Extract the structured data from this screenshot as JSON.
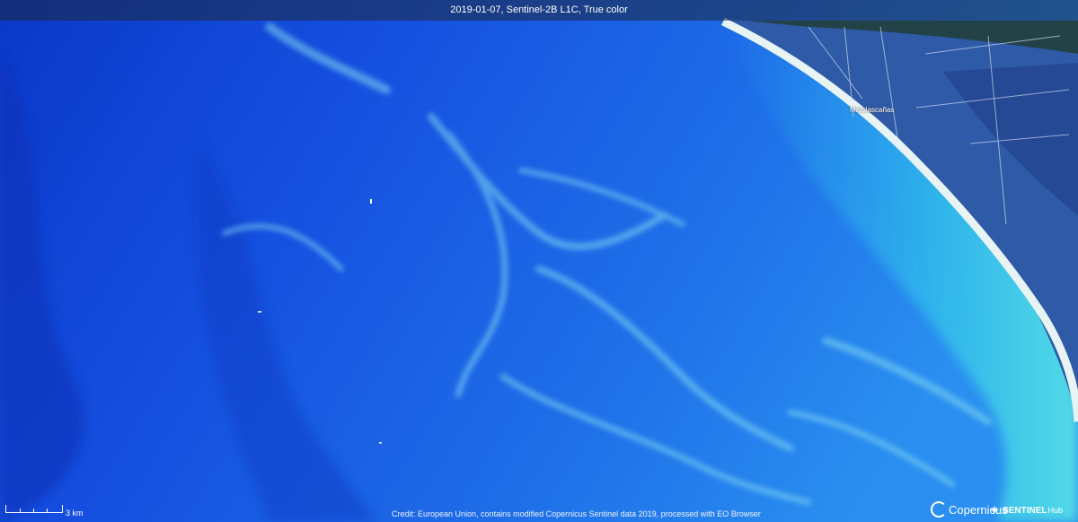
{
  "title": "2019-01-07, Sentinel-2B L1C, True color",
  "place_label": "Matalascañas",
  "scale_label": "3 km",
  "credit": "Credit: European Union, contains modified Copernicus Sentinel data 2019, processed with EO Browser",
  "logos": {
    "copernicus": "Copernicus",
    "sentinel": "SENTINEL",
    "hub": "Hub"
  },
  "icons": {
    "copernicus_mark": "copernicus-logo-icon",
    "sentinel_mark": "satellite-icon"
  },
  "colors": {
    "deep_water": "#0a3fd0",
    "mid_water": "#1f6ee8",
    "coastal_water": "#3fd9e6",
    "beach": "#e8f3f3",
    "land": "#2f5aa8",
    "dark_land": "#1e3820"
  }
}
